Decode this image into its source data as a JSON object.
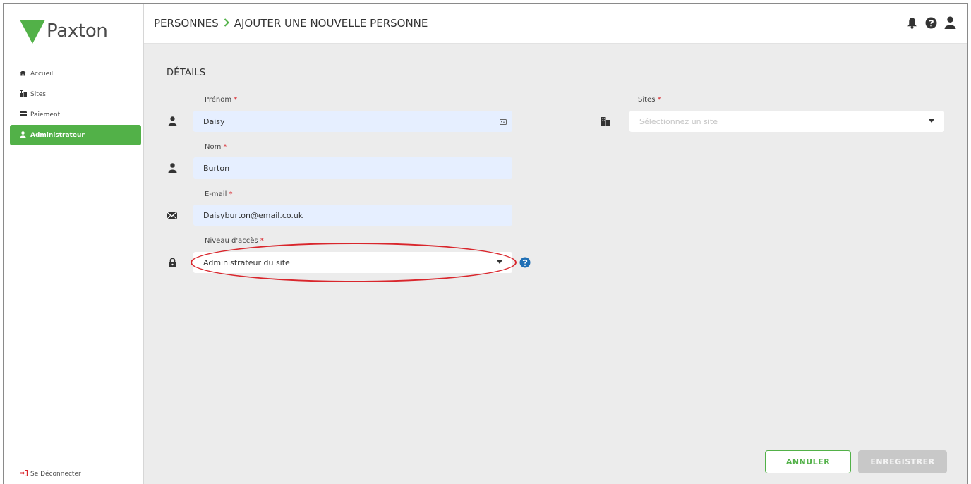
{
  "brand": {
    "name": "Paxton",
    "accent": "#52b148",
    "danger": "#d9262c"
  },
  "sidebar": {
    "items": [
      {
        "label": "Accueil",
        "icon": "home-icon"
      },
      {
        "label": "Sites",
        "icon": "building-icon"
      },
      {
        "label": "Paiement",
        "icon": "card-icon"
      },
      {
        "label": "Administrateur",
        "icon": "user-icon",
        "active": true
      }
    ],
    "logout": "Se Déconnecter"
  },
  "header": {
    "crumb_root": "PERSONNES",
    "crumb_current": "AJOUTER UNE NOUVELLE PERSONNE",
    "icons": [
      "bell-icon",
      "help-icon",
      "user-icon"
    ]
  },
  "form": {
    "section_title": "DÉTAILS",
    "first_name": {
      "label": "Prénom",
      "value": "Daisy"
    },
    "last_name": {
      "label": "Nom",
      "value": "Burton"
    },
    "email": {
      "label": "E-mail",
      "value": "Daisyburton@email.co.uk"
    },
    "access_level": {
      "label": "Niveau d'accès",
      "value": "Administrateur du site"
    },
    "sites": {
      "label": "Sites",
      "placeholder": "Sélectionnez un site"
    },
    "required_mark": "*"
  },
  "actions": {
    "cancel": "ANNULER",
    "save": "ENREGISTRER"
  }
}
